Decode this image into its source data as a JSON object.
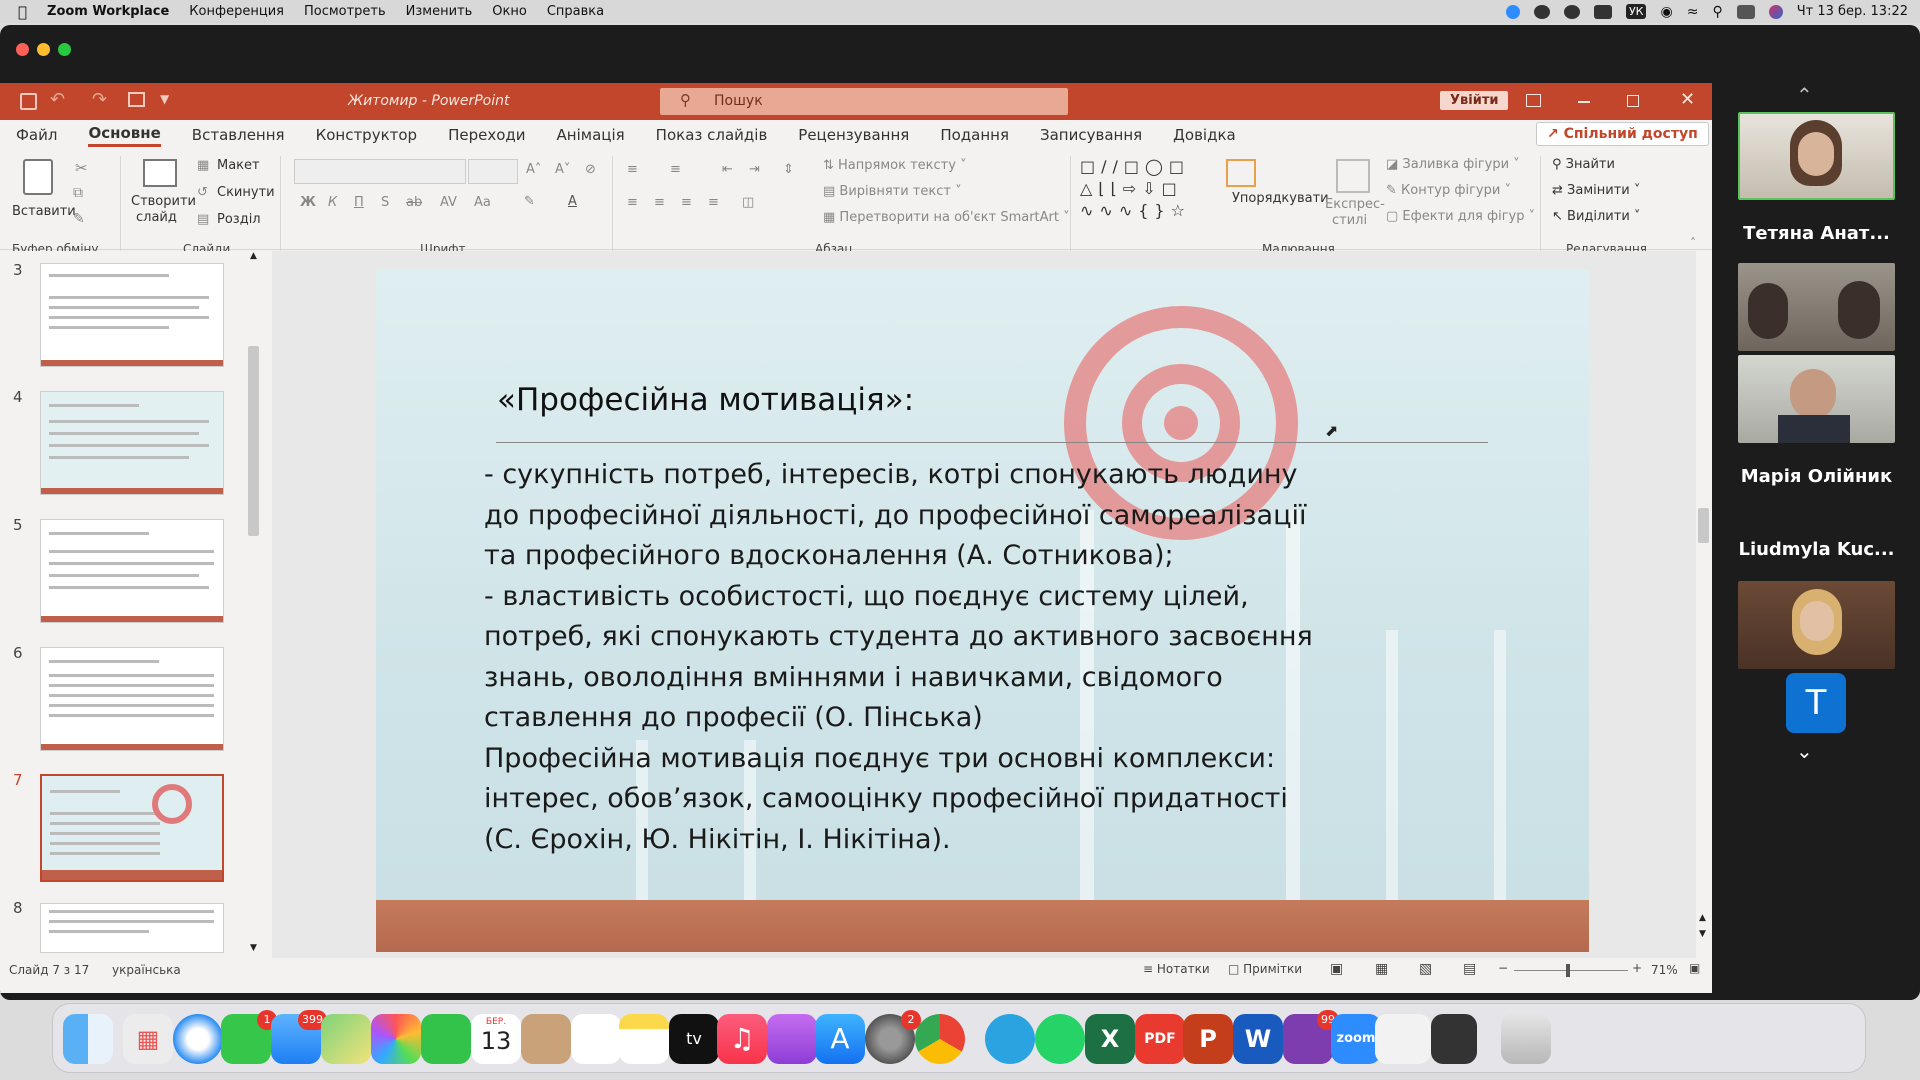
{
  "menubar": {
    "app": "Zoom Workplace",
    "items": [
      "Конференция",
      "Посмотреть",
      "Изменить",
      "Окно",
      "Справка"
    ],
    "tray_lang": "УК",
    "datetime": "Чт 13 бер.  13:22"
  },
  "ppt": {
    "window_title": "Житомир  -  PowerPoint",
    "search_placeholder": "Пошук",
    "signin": "Увійти",
    "share": "Спільний доступ",
    "tabs": [
      "Файл",
      "Основне",
      "Вставлення",
      "Конструктор",
      "Переходи",
      "Анімація",
      "Показ слайдів",
      "Рецензування",
      "Подання",
      "Записування",
      "Довідка"
    ],
    "ribbon": {
      "paste": "Вставити",
      "paste_sub": "Буфер обміну",
      "new_slide": "Створити",
      "new_slide2": "слайд",
      "layout": "Макет",
      "reset": "Скинути",
      "section": "Розділ",
      "slides_group": "Слайди",
      "font_group": "Шрифт",
      "paragraph_group": "Абзац",
      "text_dir": "Напрямок тексту",
      "align_text": "Вирівняти текст",
      "smartart": "Перетворити на об'єкт SmartArt",
      "arrange": "Упорядкувати",
      "quick_styles": "Експрес-",
      "quick_styles2": "стилі",
      "fill": "Заливка фігури",
      "outline": "Контур фігури",
      "effects": "Ефекти для фігур",
      "drawing_group": "Малювання",
      "find": "Знайти",
      "replace": "Замінити",
      "select": "Виділити",
      "editing_group": "Редагування",
      "bold": "Ж",
      "italic": "К",
      "underline": "П",
      "shadow": "S",
      "strike": "ab",
      "spacing": "AV",
      "case": "Aa"
    },
    "thumbs": [
      {
        "num": "3"
      },
      {
        "num": "4"
      },
      {
        "num": "5"
      },
      {
        "num": "6"
      },
      {
        "num": "7"
      },
      {
        "num": "8"
      }
    ],
    "slide": {
      "title": "«Професійна мотивація»:",
      "lines": [
        "- сукупність потреб, інтересів, котрі спонукають людину",
        "до професійної діяльності, до професійної самореалізації",
        "та професійного вдосконалення (А. Сотникова);",
        "- властивість особистості, що поєднує систему цілей,",
        "потреб, які спонукають студента до активного засвоєння",
        "знань, оволодіння вміннями і навичками, свідомого",
        "ставлення до професії (О. Пінська)",
        "Професійна мотивація поєднує три основні комплекси:",
        "інтерес, обов’язок, самооцінку професійної придатності",
        "(С. Єрохін, Ю. Нікітін, І. Нікітіна)."
      ]
    },
    "status": {
      "slide_of": "Слайд 7 з 17",
      "language": "українська",
      "notes": "Нотатки",
      "comments": "Примітки",
      "zoom": "71%"
    }
  },
  "participants": [
    {
      "name": "Тетяна Анат..."
    },
    {
      "name": "Марія Олійник"
    },
    {
      "name": "Liudmyla Kuc..."
    },
    {
      "initial": "T"
    }
  ],
  "dock": {
    "calendar_month": "БЕР.",
    "calendar_day": "13",
    "badges": {
      "messages": "1",
      "mail": "399",
      "settings": "2",
      "viber": "99"
    },
    "zoom_label": "zoom",
    "atv_label": "tv"
  },
  "colors": {
    "ppt_accent": "#c1462b",
    "search_bg": "#e8a893",
    "signin_bg": "#f5d7cd"
  }
}
